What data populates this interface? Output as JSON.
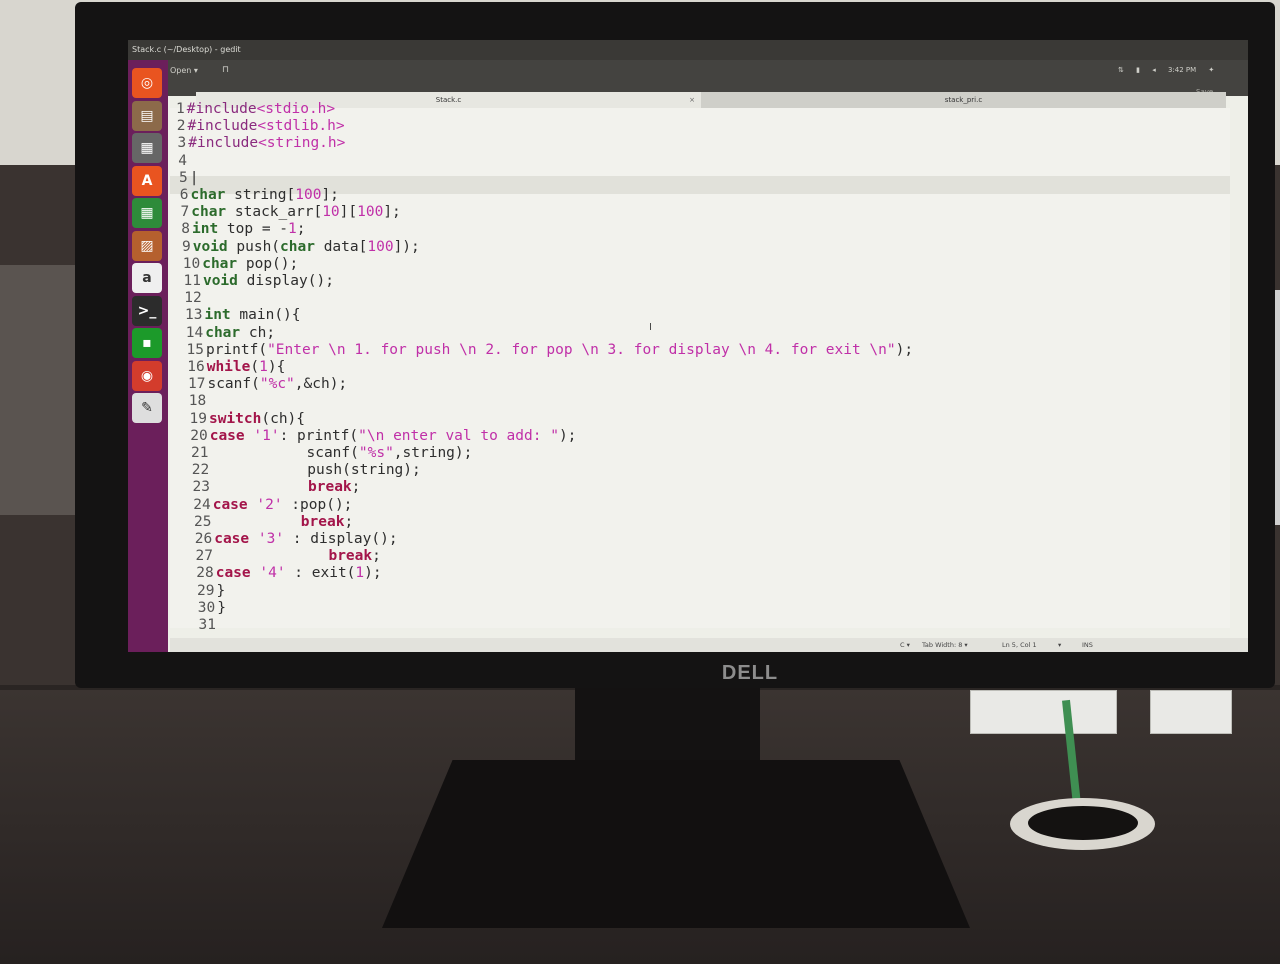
{
  "window": {
    "title": "Stack.c (~/Desktop) - gedit"
  },
  "header": {
    "open_label": "Open ▾",
    "pin_icon": "⊓",
    "time": "3:42 PM",
    "save_label": "Save"
  },
  "tabs": [
    {
      "label": "Stack.c",
      "close": "×"
    },
    {
      "label": "stack_pri.c"
    }
  ],
  "launcher": [
    {
      "name": "ubuntu-icon",
      "glyph": "◎",
      "color": "#e95420"
    },
    {
      "name": "files-icon",
      "glyph": "▤",
      "color": "#8c6a4a"
    },
    {
      "name": "document-icon",
      "glyph": "▦",
      "color": "#666"
    },
    {
      "name": "software-center-icon",
      "glyph": "A",
      "color": "#e95420"
    },
    {
      "name": "spreadsheet-icon",
      "glyph": "▦",
      "color": "#2e8b3a"
    },
    {
      "name": "presentation-icon",
      "glyph": "▨",
      "color": "#b5602e"
    },
    {
      "name": "amazon-icon",
      "glyph": "a",
      "color": "#efefef"
    },
    {
      "name": "terminal-icon",
      "glyph": ">_",
      "color": "#2c2c2c"
    },
    {
      "name": "chip-icon",
      "glyph": "▪",
      "color": "#1c9a2a"
    },
    {
      "name": "chrome-icon",
      "glyph": "◉",
      "color": "#d33c2c"
    },
    {
      "name": "text-editor-icon",
      "glyph": "✎",
      "color": "#dedede"
    }
  ],
  "code_lines": [
    {
      "n": "1",
      "t": [
        [
          "pp",
          "#include"
        ],
        [
          "str",
          "<stdio.h>"
        ]
      ]
    },
    {
      "n": "2",
      "t": [
        [
          "pp",
          "#include"
        ],
        [
          "str",
          "<stdlib.h>"
        ]
      ]
    },
    {
      "n": "3",
      "t": [
        [
          "pp",
          "#include"
        ],
        [
          "str",
          "<string.h>"
        ]
      ]
    },
    {
      "n": "4",
      "t": []
    },
    {
      "n": "5",
      "t": [
        [
          "",
          "|"
        ]
      ]
    },
    {
      "n": "6",
      "t": [
        [
          "ty",
          "char"
        ],
        [
          "",
          " string["
        ],
        [
          "num",
          "100"
        ],
        [
          "",
          "];"
        ]
      ]
    },
    {
      "n": "7",
      "t": [
        [
          "ty",
          "char"
        ],
        [
          "",
          " stack_arr["
        ],
        [
          "num",
          "10"
        ],
        [
          "",
          "]["
        ],
        [
          "num",
          "100"
        ],
        [
          "",
          "];"
        ]
      ]
    },
    {
      "n": "8",
      "t": [
        [
          "ty",
          "int"
        ],
        [
          "",
          " top = -"
        ],
        [
          "num",
          "1"
        ],
        [
          "",
          ";"
        ]
      ]
    },
    {
      "n": "9",
      "t": [
        [
          "ty",
          "void"
        ],
        [
          "",
          " push("
        ],
        [
          "ty",
          "char"
        ],
        [
          "",
          " data["
        ],
        [
          "num",
          "100"
        ],
        [
          "",
          "]);"
        ]
      ]
    },
    {
      "n": "10",
      "t": [
        [
          "ty",
          "char"
        ],
        [
          "",
          " pop();"
        ]
      ]
    },
    {
      "n": "11",
      "t": [
        [
          "ty",
          "void"
        ],
        [
          "",
          " display();"
        ]
      ]
    },
    {
      "n": "12",
      "t": []
    },
    {
      "n": "13",
      "t": [
        [
          "ty",
          "int"
        ],
        [
          "",
          " main(){"
        ]
      ]
    },
    {
      "n": "14",
      "t": [
        [
          "ty",
          "char"
        ],
        [
          "",
          " ch;"
        ]
      ]
    },
    {
      "n": "15",
      "t": [
        [
          "",
          "printf("
        ],
        [
          "str",
          "\"Enter \\n 1. for push \\n 2. for pop \\n 3. for display \\n 4. for exit \\n\""
        ],
        [
          "",
          ");"
        ]
      ]
    },
    {
      "n": "16",
      "t": [
        [
          "kw",
          "while"
        ],
        [
          "",
          "("
        ],
        [
          "num",
          "1"
        ],
        [
          "",
          "){"
        ]
      ]
    },
    {
      "n": "17",
      "t": [
        [
          "",
          "scanf("
        ],
        [
          "str",
          "\"%c\""
        ],
        [
          "",
          ",&ch);"
        ]
      ]
    },
    {
      "n": "18",
      "t": []
    },
    {
      "n": "19",
      "t": [
        [
          "kw",
          "switch"
        ],
        [
          "",
          "(ch){"
        ]
      ]
    },
    {
      "n": "20",
      "t": [
        [
          "kw",
          "case"
        ],
        [
          "",
          " "
        ],
        [
          "str",
          "'1'"
        ],
        [
          "",
          ": printf("
        ],
        [
          "str",
          "\"\\n enter val to add: \""
        ],
        [
          "",
          ");"
        ]
      ]
    },
    {
      "n": "21",
      "t": [
        [
          "",
          "           scanf("
        ],
        [
          "str",
          "\"%s\""
        ],
        [
          "",
          ",string);"
        ]
      ]
    },
    {
      "n": "22",
      "t": [
        [
          "",
          "           push(string);"
        ]
      ]
    },
    {
      "n": "23",
      "t": [
        [
          "",
          "           "
        ],
        [
          "kw",
          "break"
        ],
        [
          "",
          ";"
        ]
      ]
    },
    {
      "n": "24",
      "t": [
        [
          "kw",
          "case"
        ],
        [
          "",
          " "
        ],
        [
          "str",
          "'2'"
        ],
        [
          "",
          " :pop();"
        ]
      ]
    },
    {
      "n": "25",
      "t": [
        [
          "",
          "          "
        ],
        [
          "kw",
          "break"
        ],
        [
          "",
          ";"
        ]
      ]
    },
    {
      "n": "26",
      "t": [
        [
          "kw",
          "case"
        ],
        [
          "",
          " "
        ],
        [
          "str",
          "'3'"
        ],
        [
          "",
          " : display();"
        ]
      ]
    },
    {
      "n": "27",
      "t": [
        [
          "",
          "             "
        ],
        [
          "kw",
          "break"
        ],
        [
          "",
          ";"
        ]
      ]
    },
    {
      "n": "28",
      "t": [
        [
          "kw",
          "case"
        ],
        [
          "",
          " "
        ],
        [
          "str",
          "'4'"
        ],
        [
          "",
          " : exit("
        ],
        [
          "num",
          "1"
        ],
        [
          "",
          ");"
        ]
      ]
    },
    {
      "n": "29",
      "t": [
        [
          "",
          "}"
        ]
      ]
    },
    {
      "n": "30",
      "t": [
        [
          "",
          "}"
        ]
      ]
    },
    {
      "n": "31",
      "t": []
    }
  ],
  "statusbar": {
    "language": "C ▾",
    "tab_width": "Tab Width: 8 ▾",
    "position": "Ln 5, Col 1",
    "arrow": "▾",
    "mode": "INS"
  },
  "monitor": {
    "brand": "DELL"
  }
}
